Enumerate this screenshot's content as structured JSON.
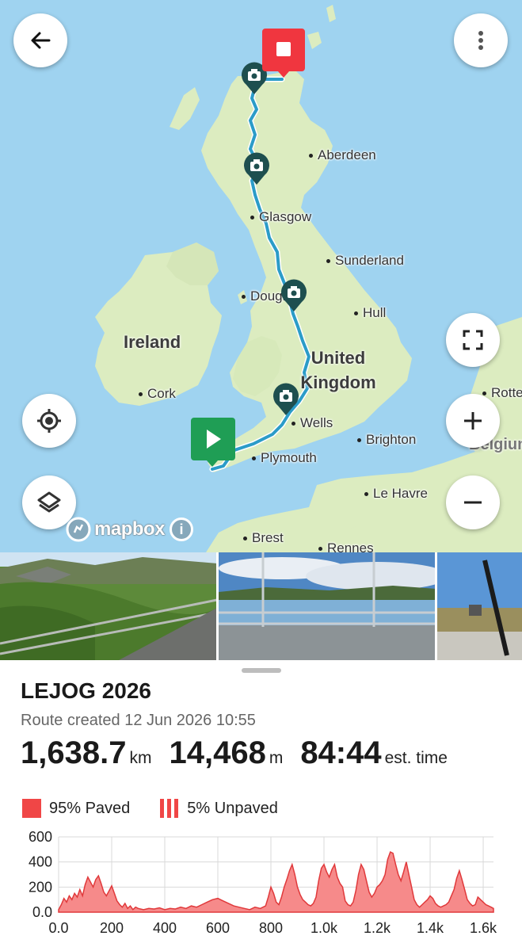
{
  "map": {
    "countries": [
      "Ireland",
      "United Kingdom"
    ],
    "cities": [
      {
        "id": "aberdeen",
        "name": "Aberdeen"
      },
      {
        "id": "glasgow",
        "name": "Glasgow"
      },
      {
        "id": "sunderland",
        "name": "Sunderland"
      },
      {
        "id": "douglas",
        "name": "Douglas"
      },
      {
        "id": "hull",
        "name": "Hull"
      },
      {
        "id": "cork",
        "name": "Cork"
      },
      {
        "id": "wells",
        "name": "Wells"
      },
      {
        "id": "brighton",
        "name": "Brighton"
      },
      {
        "id": "plymouth",
        "name": "Plymouth"
      },
      {
        "id": "lehavre",
        "name": "Le Havre"
      },
      {
        "id": "brest",
        "name": "Brest"
      },
      {
        "id": "rennes",
        "name": "Rennes"
      },
      {
        "id": "rotterdam",
        "name": "Rotte"
      },
      {
        "id": "belgium",
        "name": "Belgium"
      }
    ],
    "attribution": "mapbox",
    "route_color": "#2b9cc8",
    "start_color": "#1f9e55",
    "end_color": "#f0363f",
    "camera_pin_color": "#1e4f4f",
    "controls": {
      "back": "arrow-left-icon",
      "menu": "more-vert-icon",
      "fullscreen": "fullscreen-icon",
      "zoom_in": "plus-icon",
      "zoom_out": "minus-icon",
      "locate": "my-location-icon",
      "layers": "layers-icon"
    }
  },
  "photos": [
    "photo-1",
    "photo-2",
    "photo-3"
  ],
  "route": {
    "title": "LEJOG 2026",
    "created": "Route created 12 Jun 2026 10:55",
    "distance": "1,638.7",
    "distance_unit": "km",
    "elevation": "14,468",
    "elevation_unit": "m",
    "time": "84:44",
    "time_unit": "est. time"
  },
  "surface": {
    "paved_label": "95% Paved",
    "unpaved_label": "5% Unpaved",
    "paved_color": "#f04646"
  },
  "chart_data": {
    "type": "area",
    "title": "",
    "xlabel": "",
    "ylabel": "",
    "x_ticks": [
      "0.0",
      "200",
      "400",
      "600",
      "800",
      "1.0k",
      "1.2k",
      "1.4k",
      "1.6k"
    ],
    "y_ticks": [
      "0.0",
      "200",
      "400",
      "600"
    ],
    "xlim": [
      0,
      1638.7
    ],
    "ylim": [
      0,
      600
    ],
    "grid": true,
    "series": [
      {
        "x": [
          0,
          10,
          20,
          30,
          40,
          50,
          60,
          70,
          80,
          90,
          100,
          110,
          120,
          130,
          140,
          150,
          160,
          170,
          180,
          190,
          200,
          210,
          220,
          230,
          240,
          250,
          260,
          270,
          280,
          290,
          300,
          320,
          340,
          360,
          380,
          400,
          420,
          440,
          460,
          480,
          500,
          520,
          540,
          560,
          580,
          600,
          620,
          640,
          660,
          680,
          700,
          720,
          740,
          760,
          780,
          790,
          800,
          810,
          820,
          830,
          840,
          850,
          860,
          870,
          880,
          890,
          900,
          910,
          920,
          930,
          940,
          950,
          960,
          970,
          980,
          990,
          1000,
          1010,
          1020,
          1030,
          1040,
          1050,
          1060,
          1070,
          1080,
          1090,
          1100,
          1110,
          1120,
          1130,
          1140,
          1150,
          1160,
          1170,
          1180,
          1190,
          1200,
          1210,
          1220,
          1230,
          1240,
          1250,
          1260,
          1270,
          1280,
          1290,
          1300,
          1310,
          1320,
          1330,
          1340,
          1350,
          1360,
          1370,
          1380,
          1390,
          1400,
          1410,
          1420,
          1430,
          1440,
          1450,
          1460,
          1470,
          1480,
          1490,
          1500,
          1510,
          1520,
          1530,
          1540,
          1550,
          1560,
          1570,
          1580,
          1590,
          1600,
          1610,
          1620,
          1630,
          1638.7
        ],
        "values": [
          20,
          60,
          110,
          80,
          130,
          100,
          150,
          120,
          180,
          130,
          220,
          280,
          240,
          200,
          260,
          290,
          230,
          160,
          130,
          170,
          210,
          150,
          90,
          60,
          40,
          70,
          30,
          50,
          20,
          40,
          30,
          20,
          30,
          25,
          35,
          20,
          30,
          25,
          40,
          30,
          50,
          40,
          60,
          80,
          100,
          110,
          90,
          70,
          50,
          40,
          30,
          20,
          40,
          30,
          50,
          120,
          200,
          150,
          80,
          60,
          120,
          200,
          260,
          330,
          380,
          300,
          200,
          140,
          100,
          80,
          60,
          50,
          70,
          120,
          250,
          350,
          380,
          320,
          280,
          340,
          380,
          280,
          230,
          200,
          90,
          60,
          50,
          80,
          170,
          300,
          380,
          340,
          250,
          160,
          120,
          150,
          200,
          220,
          250,
          300,
          420,
          480,
          470,
          380,
          300,
          250,
          320,
          400,
          300,
          200,
          100,
          60,
          40,
          60,
          80,
          100,
          130,
          110,
          70,
          50,
          40,
          50,
          60,
          80,
          130,
          180,
          270,
          330,
          260,
          180,
          100,
          70,
          50,
          60,
          120,
          100,
          80,
          60,
          50,
          40,
          30
        ]
      }
    ]
  }
}
